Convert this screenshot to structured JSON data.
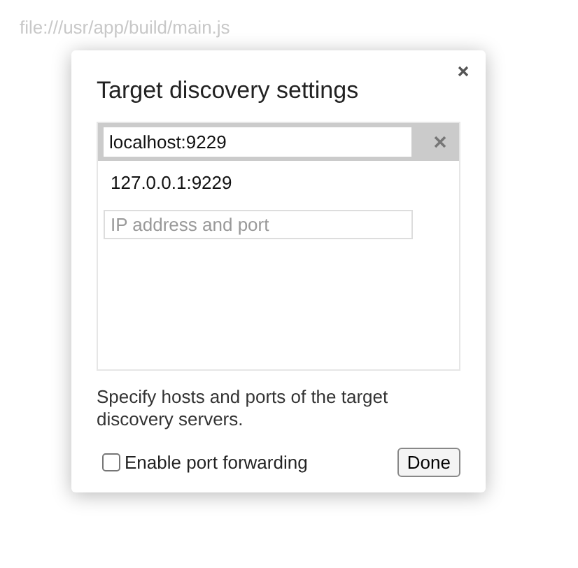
{
  "background": {
    "texts": [
      "file:///usr/app/build/main.js"
    ]
  },
  "dialog": {
    "title": "Target discovery settings",
    "entries": [
      {
        "kind": "editing",
        "value": "localhost:9229",
        "selected": true
      },
      {
        "kind": "item",
        "value": "127.0.0.1:9229",
        "selected": false
      }
    ],
    "new_entry": {
      "placeholder": "IP address and port"
    },
    "description": "Specify hosts and ports of the target discovery servers.",
    "port_forwarding": {
      "label": "Enable port forwarding",
      "checked": false
    },
    "done_button": "Done"
  }
}
